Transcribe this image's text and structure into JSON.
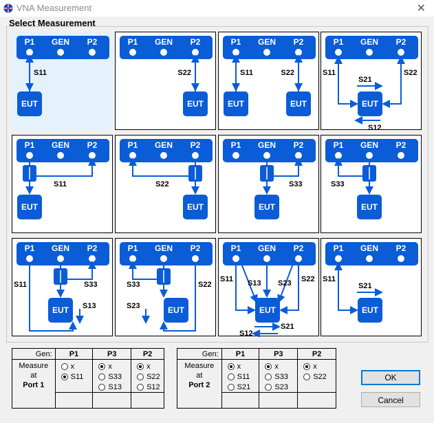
{
  "window": {
    "title": "VNA Measurement",
    "close_glyph": "✕"
  },
  "section_title": "Select Measurement",
  "colors": {
    "block": "#0a5cd7",
    "tile_selected": "#e5f1fb"
  },
  "common_labels": {
    "p1": "P1",
    "gen": "GEN",
    "p2": "P2",
    "eut": "EUT"
  },
  "tiles": [
    {
      "id": "s11",
      "selected": true,
      "labels": [
        "S11"
      ]
    },
    {
      "id": "s22",
      "selected": false,
      "labels": [
        "S22"
      ]
    },
    {
      "id": "s11-s22",
      "selected": false,
      "labels": [
        "S11",
        "S22"
      ]
    },
    {
      "id": "full-2port",
      "selected": false,
      "labels": [
        "S11",
        "S22",
        "S21",
        "S12"
      ]
    },
    {
      "id": "s11-coupler-left",
      "selected": false,
      "labels": [
        "S11"
      ]
    },
    {
      "id": "s22-coupler-right",
      "selected": false,
      "labels": [
        "S22"
      ]
    },
    {
      "id": "s33-coupler-left",
      "selected": false,
      "labels": [
        "S33"
      ]
    },
    {
      "id": "s33-coupler-right",
      "selected": false,
      "labels": [
        "S33"
      ]
    },
    {
      "id": "s11-s33-s13",
      "selected": false,
      "labels": [
        "S11",
        "S33",
        "S13"
      ]
    },
    {
      "id": "s33-s23-s22",
      "selected": false,
      "labels": [
        "S33",
        "S23",
        "S22"
      ]
    },
    {
      "id": "full-3port",
      "selected": false,
      "labels": [
        "S11",
        "S13",
        "S23",
        "S22",
        "S21",
        "S12"
      ]
    },
    {
      "id": "s11-s21",
      "selected": false,
      "labels": [
        "S11",
        "S21"
      ]
    }
  ],
  "port1_table": {
    "gen_label": "Gen:",
    "col_headers": [
      "P1",
      "P3",
      "P2"
    ],
    "measure_lines": [
      "Measure",
      "at",
      "Port 1"
    ],
    "columns": [
      {
        "options": [
          "x",
          "S11"
        ],
        "selected": 1
      },
      {
        "options": [
          "x",
          "S33",
          "S13"
        ],
        "selected": 0
      },
      {
        "options": [
          "x",
          "S22",
          "S12"
        ],
        "selected": 0
      }
    ]
  },
  "port2_table": {
    "gen_label": "Gen:",
    "col_headers": [
      "P1",
      "P3",
      "P2"
    ],
    "measure_lines": [
      "Measure",
      "at",
      "Port 2"
    ],
    "columns": [
      {
        "options": [
          "x",
          "S11",
          "S21"
        ],
        "selected": 0
      },
      {
        "options": [
          "x",
          "S33",
          "S23"
        ],
        "selected": 0
      },
      {
        "options": [
          "x",
          "S22"
        ],
        "selected": 0
      }
    ]
  },
  "buttons": {
    "ok": "OK",
    "cancel": "Cancel"
  }
}
